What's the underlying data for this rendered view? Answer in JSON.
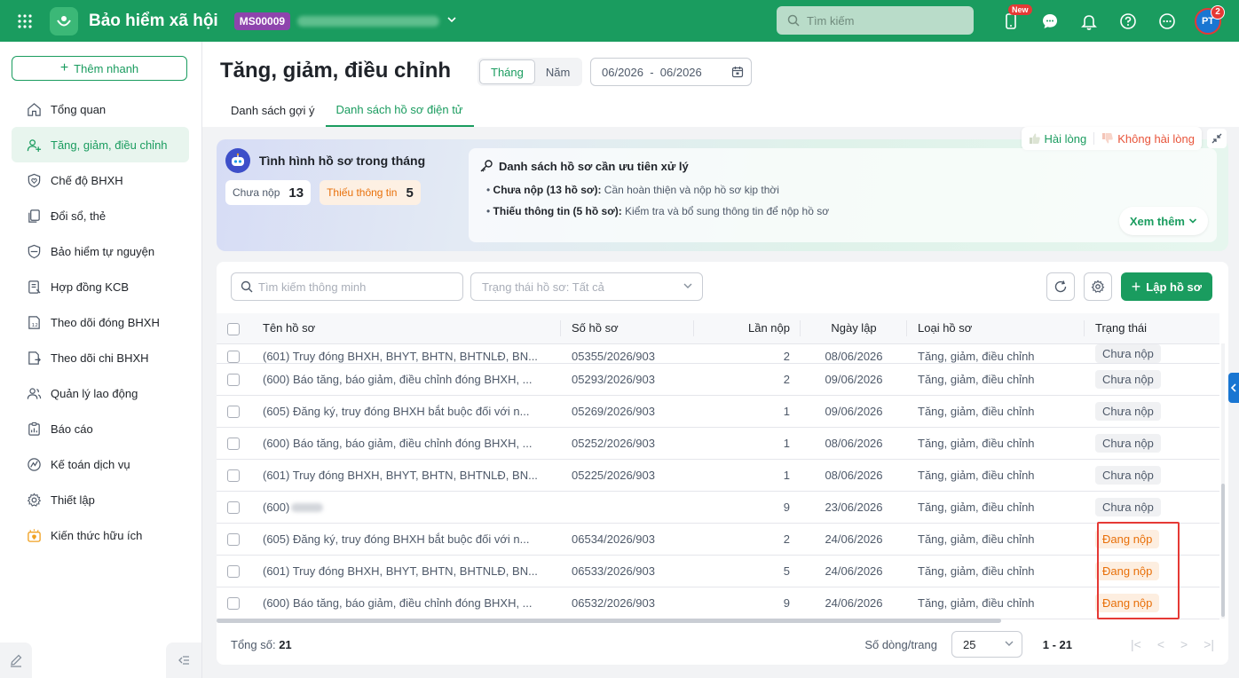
{
  "topbar": {
    "app_title": "Bảo hiểm xã hội",
    "company_code": "MS00009",
    "search_placeholder": "Tìm kiếm",
    "new_badge": "New",
    "avatar_initials": "PT",
    "notification_count": "2",
    "colors": {
      "brand": "#1a9c5f"
    }
  },
  "sidebar": {
    "quick_add": "Thêm nhanh",
    "items": [
      {
        "label": "Tổng quan",
        "icon": "home-icon"
      },
      {
        "label": "Tăng, giảm, điều chỉnh",
        "icon": "user-plus-icon",
        "active": true
      },
      {
        "label": "Chế độ BHXH",
        "icon": "shield-heart-icon"
      },
      {
        "label": "Đổi sổ, thẻ",
        "icon": "copy-card-icon"
      },
      {
        "label": "Bảo hiểm tự nguyện",
        "icon": "shield-icon"
      },
      {
        "label": "Hợp đồng KCB",
        "icon": "contract-icon"
      },
      {
        "label": "Theo dõi đóng BHXH",
        "icon": "calendar-12-icon"
      },
      {
        "label": "Theo dõi chi BHXH",
        "icon": "file-out-icon"
      },
      {
        "label": "Quản lý lao động",
        "icon": "users-icon"
      },
      {
        "label": "Báo cáo",
        "icon": "clipboard-icon"
      },
      {
        "label": "Kế toán dịch vụ",
        "icon": "accounting-icon"
      },
      {
        "label": "Thiết lập",
        "icon": "gear-icon"
      },
      {
        "label": "Kiến thức hữu ích",
        "icon": "lightbulb-icon"
      }
    ]
  },
  "header": {
    "page_title": "Tăng, giảm, điều chỉnh",
    "period_month": "Tháng",
    "period_year": "Năm",
    "date_range": "06/2026  -  06/2026",
    "tabs": [
      {
        "label": "Danh sách gợi ý"
      },
      {
        "label": "Danh sách hồ sơ điện tử",
        "active": true
      }
    ]
  },
  "summary": {
    "feedback_good": "Hài lòng",
    "feedback_bad": "Không hài lòng",
    "title": "Tình hình hồ sơ trong tháng",
    "chip_pending_label": "Chưa nộp",
    "chip_pending_count": "13",
    "chip_missing_label": "Thiếu thông tin",
    "chip_missing_count": "5",
    "priority_title": "Danh sách hồ sơ cần ưu tiên xử lý",
    "line1_bold": "Chưa nộp (13 hồ sơ):",
    "line1_text": " Cần hoàn thiện và nộp hồ sơ kịp thời",
    "line2_bold": "Thiếu thông tin (5 hồ sơ):",
    "line2_text": " Kiểm tra và bổ sung thông tin để nộp hồ sơ",
    "more": "Xem thêm"
  },
  "table": {
    "search_placeholder": "Tìm kiếm thông minh",
    "status_placeholder": "Trạng thái hồ sơ: Tất cả",
    "create_label": "Lập hồ sơ",
    "columns": [
      "Tên hồ sơ",
      "Số hồ sơ",
      "Lần nộp",
      "Ngày lập",
      "Loại hồ sơ",
      "Trạng thái"
    ],
    "partial_row": {
      "name": "(601) Truy đóng BHXH, BHYT, BHTN, BHTNLĐ, BN...",
      "code": "05355/2026/903",
      "times": "2",
      "date": "08/06/2026",
      "type": "Tăng, giảm, điều chỉnh",
      "status": "Chưa nộp"
    },
    "rows": [
      {
        "name": "(600) Báo tăng, báo giảm, điều chỉnh đóng BHXH, ...",
        "code": "05293/2026/903",
        "times": "2",
        "date": "09/06/2026",
        "type": "Tăng, giảm, điều chỉnh",
        "status": "Chưa nộp",
        "tone": "gray"
      },
      {
        "name": "(605) Đăng ký, truy đóng BHXH bắt buộc đối với n...",
        "code": "05269/2026/903",
        "times": "1",
        "date": "09/06/2026",
        "type": "Tăng, giảm, điều chỉnh",
        "status": "Chưa nộp",
        "tone": "gray"
      },
      {
        "name": "(600) Báo tăng, báo giảm, điều chỉnh đóng BHXH, ...",
        "code": "05252/2026/903",
        "times": "1",
        "date": "08/06/2026",
        "type": "Tăng, giảm, điều chỉnh",
        "status": "Chưa nộp",
        "tone": "gray"
      },
      {
        "name": "(601) Truy đóng BHXH, BHYT, BHTN, BHTNLĐ, BN...",
        "code": "05225/2026/903",
        "times": "1",
        "date": "08/06/2026",
        "type": "Tăng, giảm, điều chỉnh",
        "status": "Chưa nộp",
        "tone": "gray"
      },
      {
        "name": "(600)",
        "code": "",
        "times": "9",
        "date": "23/06/2026",
        "type": "Tăng, giảm, điều chỉnh",
        "status": "Chưa nộp",
        "tone": "gray",
        "blurred": true
      },
      {
        "name": "(605) Đăng ký, truy đóng BHXH bắt buộc đối với n...",
        "code": "06534/2026/903",
        "times": "2",
        "date": "24/06/2026",
        "type": "Tăng, giảm, điều chỉnh",
        "status": "Đang nộp",
        "tone": "orange"
      },
      {
        "name": "(601) Truy đóng BHXH, BHYT, BHTN, BHTNLĐ, BN...",
        "code": "06533/2026/903",
        "times": "5",
        "date": "24/06/2026",
        "type": "Tăng, giảm, điều chỉnh",
        "status": "Đang nộp",
        "tone": "orange"
      },
      {
        "name": "(600) Báo tăng, báo giảm, điều chỉnh đóng BHXH, ...",
        "code": "06532/2026/903",
        "times": "9",
        "date": "24/06/2026",
        "type": "Tăng, giảm, điều chỉnh",
        "status": "Đang nộp",
        "tone": "orange"
      }
    ],
    "total_label": "Tổng số: ",
    "total_value": "21",
    "rows_per_page_label": "Số dòng/trang",
    "rows_per_page": "25",
    "range": "1 - 21"
  }
}
